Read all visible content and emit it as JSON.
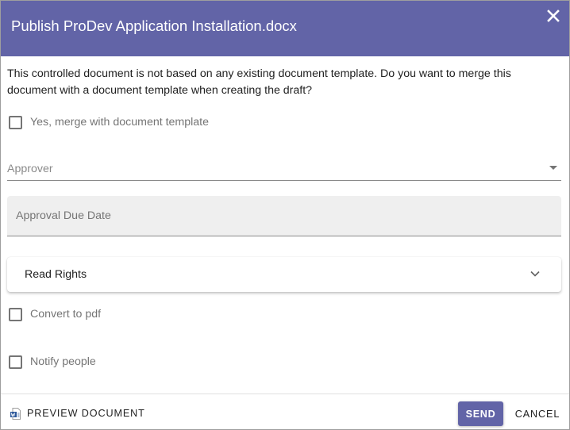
{
  "dialog": {
    "title": "Publish ProDev Application Installation.docx",
    "accent_color": "#6264a7"
  },
  "intro_text": "This controlled document is not based on any existing document template. Do you want to merge this document with a document template when creating the draft?",
  "merge_checkbox": {
    "label": "Yes, merge with document template",
    "checked": false
  },
  "approver": {
    "label": "Approver",
    "value": ""
  },
  "approval_due_date": {
    "label": "Approval Due Date",
    "value": ""
  },
  "read_rights": {
    "label": "Read Rights",
    "expanded": false
  },
  "convert_pdf_checkbox": {
    "label": "Convert to pdf",
    "checked": false
  },
  "notify_checkbox": {
    "label": "Notify people",
    "checked": false
  },
  "footer": {
    "preview_label": "PREVIEW DOCUMENT",
    "send_label": "SEND",
    "cancel_label": "CANCEL"
  },
  "icons": {
    "close": "close-icon",
    "dropdown": "dropdown-arrow-icon",
    "chevron": "chevron-down-icon",
    "preview": "word-document-icon"
  }
}
